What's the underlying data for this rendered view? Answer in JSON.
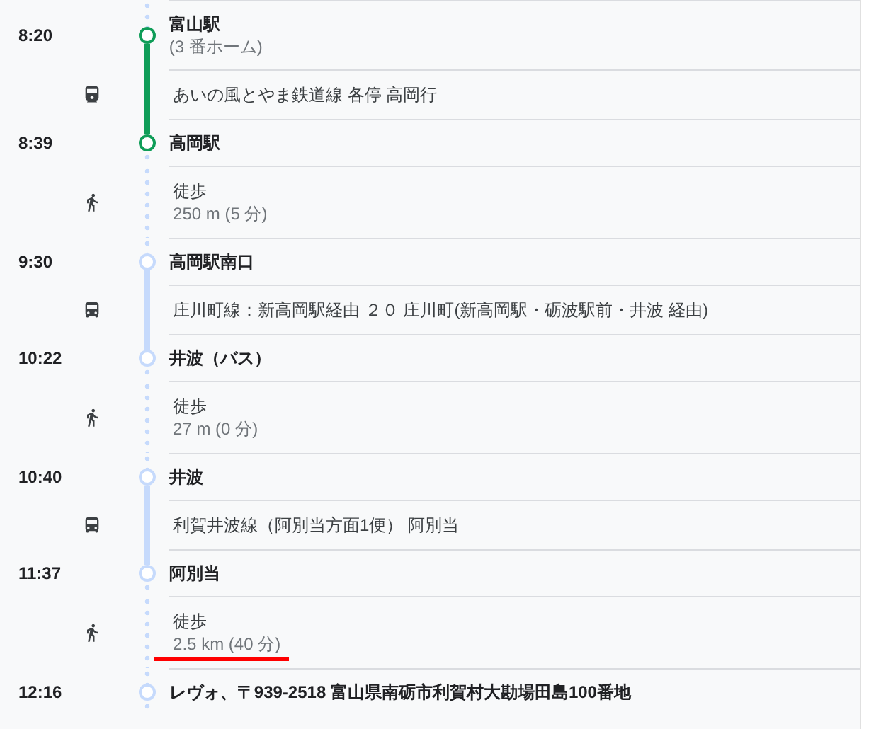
{
  "steps": [
    {
      "kind": "stop",
      "time": "8:20",
      "name": "富山駅",
      "platform": "(3 番ホーム)"
    },
    {
      "kind": "train",
      "color": "#0f9d58",
      "lines": [
        "あいの風とやま鉄道線 各停 高岡行"
      ]
    },
    {
      "kind": "stop",
      "time": "8:39",
      "name": "高岡駅"
    },
    {
      "kind": "walk",
      "color": "#c6dafc",
      "lines": [
        "徒歩",
        "250 m (5 分)"
      ]
    },
    {
      "kind": "stop",
      "time": "9:30",
      "name": "高岡駅南口"
    },
    {
      "kind": "bus",
      "color": "#c6dafc",
      "lines": [
        "庄川町線：新高岡駅経由 ２０ 庄川町(新高岡駅・砺波駅前・井波 経由)"
      ]
    },
    {
      "kind": "stop",
      "time": "10:22",
      "name": "井波（バス）"
    },
    {
      "kind": "walk",
      "color": "#c6dafc",
      "lines": [
        "徒歩",
        "27 m (0 分)"
      ]
    },
    {
      "kind": "stop",
      "time": "10:40",
      "name": "井波"
    },
    {
      "kind": "bus",
      "color": "#c6dafc",
      "lines": [
        "利賀井波線（阿別当方面1便） 阿別当"
      ]
    },
    {
      "kind": "stop",
      "time": "11:37",
      "name": "阿別当"
    },
    {
      "kind": "walk",
      "color": "#c6dafc",
      "lines": [
        "徒歩",
        "2.5 km (40 分)"
      ],
      "underlined": true
    },
    {
      "kind": "stop",
      "time": "12:16",
      "name": "レヴォ、〒939-2518 富山県南砺市利賀村大勘場田島100番地"
    }
  ]
}
